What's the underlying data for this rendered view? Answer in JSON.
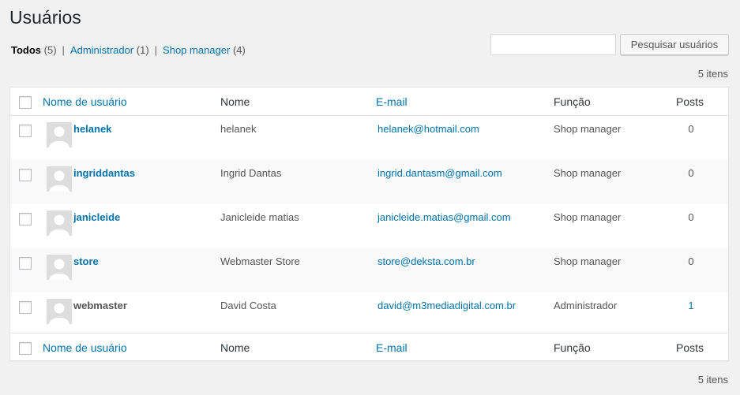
{
  "page_title": "Usuários",
  "filters": {
    "all_label": "Todos",
    "all_count": "(5)",
    "admin_label": "Administrador",
    "admin_count": "(1)",
    "shop_label": "Shop manager",
    "shop_count": "(4)",
    "separator": "|"
  },
  "search": {
    "value": "",
    "button_label": "Pesquisar usuários"
  },
  "items_count": "5 itens",
  "columns": {
    "username": "Nome de usuário",
    "name": "Nome",
    "email": "E-mail",
    "role": "Função",
    "posts": "Posts"
  },
  "rows": [
    {
      "username": "helanek",
      "name": "helanek",
      "email": "helanek@hotmail.com",
      "role": "Shop manager",
      "posts": "0"
    },
    {
      "username": "ingriddantas",
      "name": "Ingrid Dantas",
      "email": "ingrid.dantasm@gmail.com",
      "role": "Shop manager",
      "posts": "0"
    },
    {
      "username": "janicleide",
      "name": "Janicleide matias",
      "email": "janicleide.matias@gmail.com",
      "role": "Shop manager",
      "posts": "0"
    },
    {
      "username": "store",
      "name": "Webmaster Store",
      "email": "store@deksta.com.br",
      "role": "Shop manager",
      "posts": "0"
    },
    {
      "username": "webmaster",
      "name": "David Costa",
      "email": "david@m3mediadigital.com.br",
      "role": "Administrador",
      "posts": "1"
    }
  ],
  "colors": {
    "link": "#0073aa",
    "background": "#f1f1f1"
  }
}
